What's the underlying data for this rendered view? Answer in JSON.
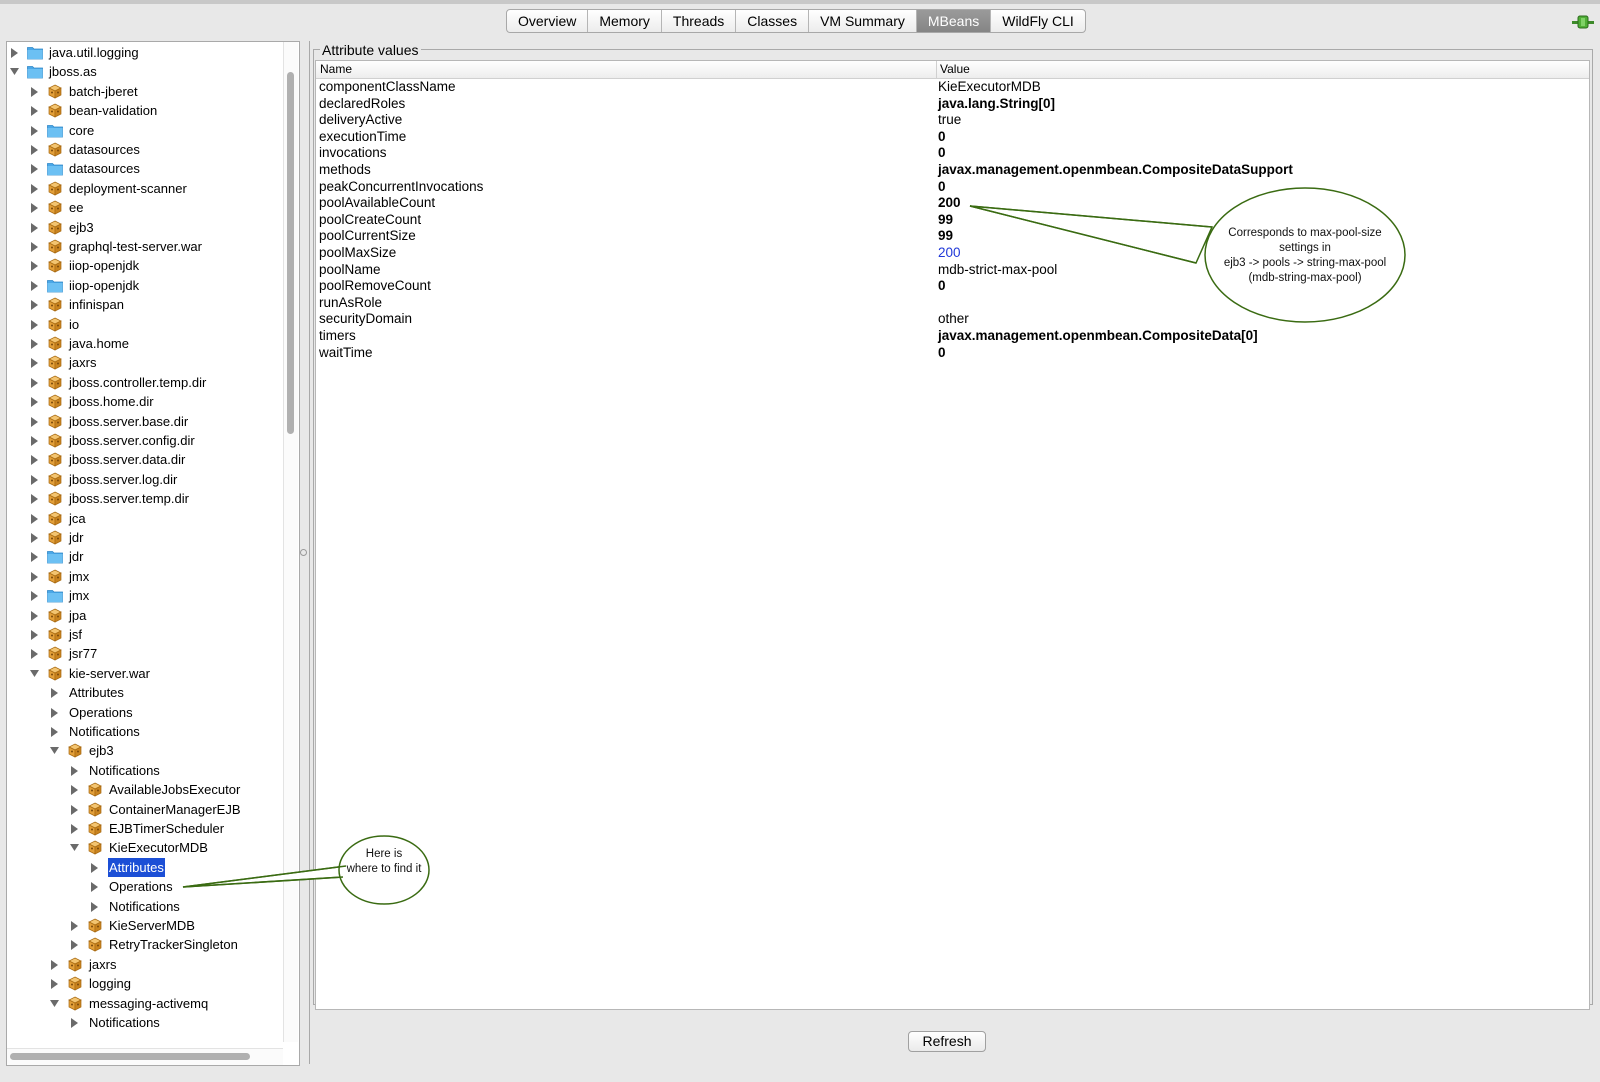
{
  "tabs": [
    {
      "label": "Overview",
      "active": false
    },
    {
      "label": "Memory",
      "active": false
    },
    {
      "label": "Threads",
      "active": false
    },
    {
      "label": "Classes",
      "active": false
    },
    {
      "label": "VM Summary",
      "active": false
    },
    {
      "label": "MBeans",
      "active": true
    },
    {
      "label": "WildFly CLI",
      "active": false
    }
  ],
  "tree": [
    {
      "label": "java.util.logging",
      "depth": 0,
      "state": "collapsed",
      "icon": "folder-icon"
    },
    {
      "label": "jboss.as",
      "depth": 0,
      "state": "expanded",
      "icon": "folder-icon"
    },
    {
      "label": "batch-jberet",
      "depth": 1,
      "state": "collapsed",
      "icon": "mbean-icon"
    },
    {
      "label": "bean-validation",
      "depth": 1,
      "state": "collapsed",
      "icon": "mbean-icon"
    },
    {
      "label": "core",
      "depth": 1,
      "state": "collapsed",
      "icon": "folder-icon"
    },
    {
      "label": "datasources",
      "depth": 1,
      "state": "collapsed",
      "icon": "mbean-icon"
    },
    {
      "label": "datasources",
      "depth": 1,
      "state": "collapsed",
      "icon": "folder-icon"
    },
    {
      "label": "deployment-scanner",
      "depth": 1,
      "state": "collapsed",
      "icon": "mbean-icon"
    },
    {
      "label": "ee",
      "depth": 1,
      "state": "collapsed",
      "icon": "mbean-icon"
    },
    {
      "label": "ejb3",
      "depth": 1,
      "state": "collapsed",
      "icon": "mbean-icon"
    },
    {
      "label": "graphql-test-server.war",
      "depth": 1,
      "state": "collapsed",
      "icon": "mbean-icon"
    },
    {
      "label": "iiop-openjdk",
      "depth": 1,
      "state": "collapsed",
      "icon": "mbean-icon"
    },
    {
      "label": "iiop-openjdk",
      "depth": 1,
      "state": "collapsed",
      "icon": "folder-icon"
    },
    {
      "label": "infinispan",
      "depth": 1,
      "state": "collapsed",
      "icon": "mbean-icon"
    },
    {
      "label": "io",
      "depth": 1,
      "state": "collapsed",
      "icon": "mbean-icon"
    },
    {
      "label": "java.home",
      "depth": 1,
      "state": "collapsed",
      "icon": "mbean-icon"
    },
    {
      "label": "jaxrs",
      "depth": 1,
      "state": "collapsed",
      "icon": "mbean-icon"
    },
    {
      "label": "jboss.controller.temp.dir",
      "depth": 1,
      "state": "collapsed",
      "icon": "mbean-icon"
    },
    {
      "label": "jboss.home.dir",
      "depth": 1,
      "state": "collapsed",
      "icon": "mbean-icon"
    },
    {
      "label": "jboss.server.base.dir",
      "depth": 1,
      "state": "collapsed",
      "icon": "mbean-icon"
    },
    {
      "label": "jboss.server.config.dir",
      "depth": 1,
      "state": "collapsed",
      "icon": "mbean-icon"
    },
    {
      "label": "jboss.server.data.dir",
      "depth": 1,
      "state": "collapsed",
      "icon": "mbean-icon"
    },
    {
      "label": "jboss.server.log.dir",
      "depth": 1,
      "state": "collapsed",
      "icon": "mbean-icon"
    },
    {
      "label": "jboss.server.temp.dir",
      "depth": 1,
      "state": "collapsed",
      "icon": "mbean-icon"
    },
    {
      "label": "jca",
      "depth": 1,
      "state": "collapsed",
      "icon": "mbean-icon"
    },
    {
      "label": "jdr",
      "depth": 1,
      "state": "collapsed",
      "icon": "mbean-icon"
    },
    {
      "label": "jdr",
      "depth": 1,
      "state": "collapsed",
      "icon": "folder-icon"
    },
    {
      "label": "jmx",
      "depth": 1,
      "state": "collapsed",
      "icon": "mbean-icon"
    },
    {
      "label": "jmx",
      "depth": 1,
      "state": "collapsed",
      "icon": "folder-icon"
    },
    {
      "label": "jpa",
      "depth": 1,
      "state": "collapsed",
      "icon": "mbean-icon"
    },
    {
      "label": "jsf",
      "depth": 1,
      "state": "collapsed",
      "icon": "mbean-icon"
    },
    {
      "label": "jsr77",
      "depth": 1,
      "state": "collapsed",
      "icon": "mbean-icon"
    },
    {
      "label": "kie-server.war",
      "depth": 1,
      "state": "expanded",
      "icon": "mbean-icon"
    },
    {
      "label": "Attributes",
      "depth": 2,
      "state": "collapsed",
      "icon": ""
    },
    {
      "label": "Operations",
      "depth": 2,
      "state": "collapsed",
      "icon": ""
    },
    {
      "label": "Notifications",
      "depth": 2,
      "state": "collapsed",
      "icon": ""
    },
    {
      "label": "ejb3",
      "depth": 2,
      "state": "expanded",
      "icon": "mbean-icon"
    },
    {
      "label": "Notifications",
      "depth": 3,
      "state": "collapsed",
      "icon": ""
    },
    {
      "label": "AvailableJobsExecutor",
      "depth": 3,
      "state": "collapsed",
      "icon": "mbean-icon"
    },
    {
      "label": "ContainerManagerEJB",
      "depth": 3,
      "state": "collapsed",
      "icon": "mbean-icon"
    },
    {
      "label": "EJBTimerScheduler",
      "depth": 3,
      "state": "collapsed",
      "icon": "mbean-icon"
    },
    {
      "label": "KieExecutorMDB",
      "depth": 3,
      "state": "expanded",
      "icon": "mbean-icon"
    },
    {
      "label": "Attributes",
      "depth": 4,
      "state": "collapsed",
      "icon": "",
      "selected": true
    },
    {
      "label": "Operations",
      "depth": 4,
      "state": "collapsed",
      "icon": ""
    },
    {
      "label": "Notifications",
      "depth": 4,
      "state": "collapsed",
      "icon": ""
    },
    {
      "label": "KieServerMDB",
      "depth": 3,
      "state": "collapsed",
      "icon": "mbean-icon"
    },
    {
      "label": "RetryTrackerSingleton",
      "depth": 3,
      "state": "collapsed",
      "icon": "mbean-icon"
    },
    {
      "label": "jaxrs",
      "depth": 2,
      "state": "collapsed",
      "icon": "mbean-icon"
    },
    {
      "label": "logging",
      "depth": 2,
      "state": "collapsed",
      "icon": "mbean-icon"
    },
    {
      "label": "messaging-activemq",
      "depth": 2,
      "state": "expanded",
      "icon": "mbean-icon"
    },
    {
      "label": "Notifications",
      "depth": 3,
      "state": "collapsed",
      "icon": ""
    }
  ],
  "attributes": {
    "legend": "Attribute values",
    "col_name": "Name",
    "col_value": "Value",
    "rows": [
      {
        "name": "componentClassName",
        "value": "KieExecutorMDB",
        "style": "normal"
      },
      {
        "name": "declaredRoles",
        "value": "java.lang.String[0]",
        "style": "bold"
      },
      {
        "name": "deliveryActive",
        "value": "true",
        "style": "normal"
      },
      {
        "name": "executionTime",
        "value": "0",
        "style": "bold"
      },
      {
        "name": "invocations",
        "value": "0",
        "style": "bold"
      },
      {
        "name": "methods",
        "value": "javax.management.openmbean.CompositeDataSupport",
        "style": "bold"
      },
      {
        "name": "peakConcurrentInvocations",
        "value": "0",
        "style": "bold"
      },
      {
        "name": "poolAvailableCount",
        "value": "200",
        "style": "bold"
      },
      {
        "name": "poolCreateCount",
        "value": "99",
        "style": "bold"
      },
      {
        "name": "poolCurrentSize",
        "value": "99",
        "style": "bold"
      },
      {
        "name": "poolMaxSize",
        "value": "200",
        "style": "link"
      },
      {
        "name": "poolName",
        "value": "mdb-strict-max-pool",
        "style": "normal"
      },
      {
        "name": "poolRemoveCount",
        "value": "0",
        "style": "bold"
      },
      {
        "name": "runAsRole",
        "value": "",
        "style": "normal"
      },
      {
        "name": "securityDomain",
        "value": "other",
        "style": "normal"
      },
      {
        "name": "timers",
        "value": "javax.management.openmbean.CompositeData[0]",
        "style": "bold"
      },
      {
        "name": "waitTime",
        "value": "0",
        "style": "bold"
      }
    ]
  },
  "refresh_label": "Refresh",
  "annotations": {
    "pool_note": [
      "Corresponds to max-pool-size",
      "settings in",
      "ejb3 -> pools -> string-max-pool",
      "(mdb-string-max-pool)"
    ],
    "find_note": [
      "Here is",
      "where to find it"
    ]
  },
  "colors": {
    "selection": "#1c4fd6",
    "link_value": "#2038d8",
    "callout_stroke": "#3a6b12",
    "folder": "#4aa8e8",
    "mbean": "#e3a03a"
  },
  "icons": {
    "connection": "connection-plug-icon",
    "folder": "folder-icon",
    "mbean": "mbean-icon",
    "expand": "triangle-right-icon",
    "collapse": "triangle-down-icon"
  }
}
